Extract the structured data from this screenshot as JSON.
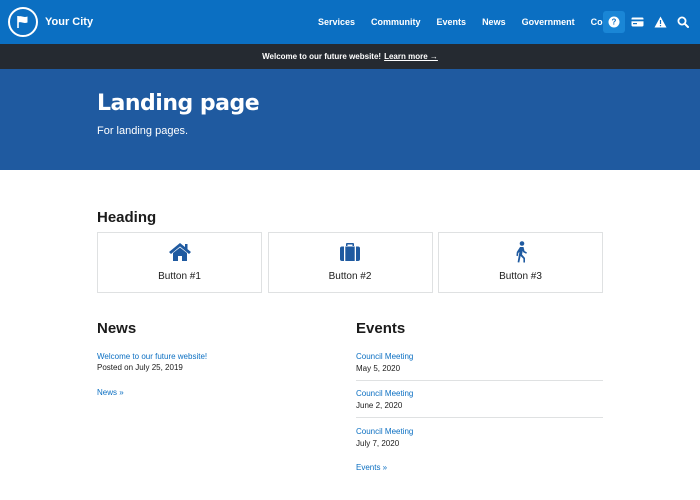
{
  "header": {
    "brand_name": "Your City",
    "nav": [
      "Services",
      "Community",
      "Events",
      "News",
      "Government",
      "Contact"
    ],
    "icons": [
      "help-icon",
      "payment-card-icon",
      "alert-icon",
      "search-icon"
    ],
    "brand_color": "#0b6fc2"
  },
  "announcement": {
    "text": "Welcome to our future website!",
    "link_label": "Learn more →"
  },
  "hero": {
    "title": "Landing page",
    "subtitle": "For landing pages."
  },
  "main": {
    "heading": "Heading",
    "buttons": [
      {
        "label": "Button #1",
        "icon": "home-icon"
      },
      {
        "label": "Button #2",
        "icon": "briefcase-icon"
      },
      {
        "label": "Button #3",
        "icon": "walking-person-icon"
      }
    ]
  },
  "news": {
    "heading": "News",
    "items": [
      {
        "title": "Welcome to our future website!",
        "date": "Posted on July 25, 2019"
      }
    ],
    "more_label": "News »"
  },
  "events": {
    "heading": "Events",
    "items": [
      {
        "title": "Council Meeting",
        "date": "May 5, 2020"
      },
      {
        "title": "Council Meeting",
        "date": "June 2, 2020"
      },
      {
        "title": "Council Meeting",
        "date": "July 7, 2020"
      }
    ],
    "more_label": "Events »"
  }
}
